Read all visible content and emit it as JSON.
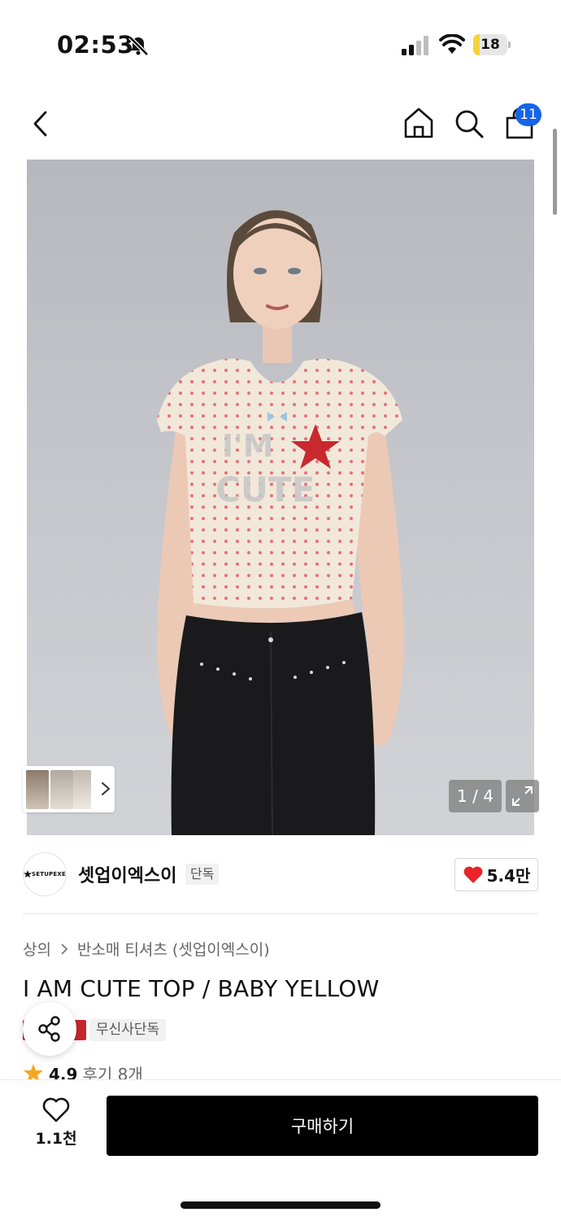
{
  "status_bar": {
    "time": "02:53",
    "battery": "18",
    "battery_level_percent": 18,
    "battery_color": "#f5d33c"
  },
  "header": {
    "cart_count": "11",
    "badge_color": "#1565e8"
  },
  "gallery": {
    "counter": "1 / 4",
    "current_index": 1,
    "total": 4
  },
  "brand": {
    "logo_text": "SETUPEXE",
    "name": "셋업이엑스이",
    "exclusive_tag": "단독",
    "likes": "5.4만"
  },
  "breadcrumb": {
    "items": [
      "상의",
      "반소매 티셔츠 (셋업이엑스이)"
    ]
  },
  "product": {
    "title": "I AM CUTE TOP / BABY YELLOW",
    "badge_store": "무신사단독",
    "rating": "4.9",
    "reviews": "후기 8개"
  },
  "bottom_bar": {
    "wish_count": "1.1천",
    "buy_label": "구매하기"
  },
  "colors": {
    "accent_red": "#c8252c",
    "heart_red": "#e8232a",
    "buy_button": "#000000",
    "star": "#f5a623"
  }
}
